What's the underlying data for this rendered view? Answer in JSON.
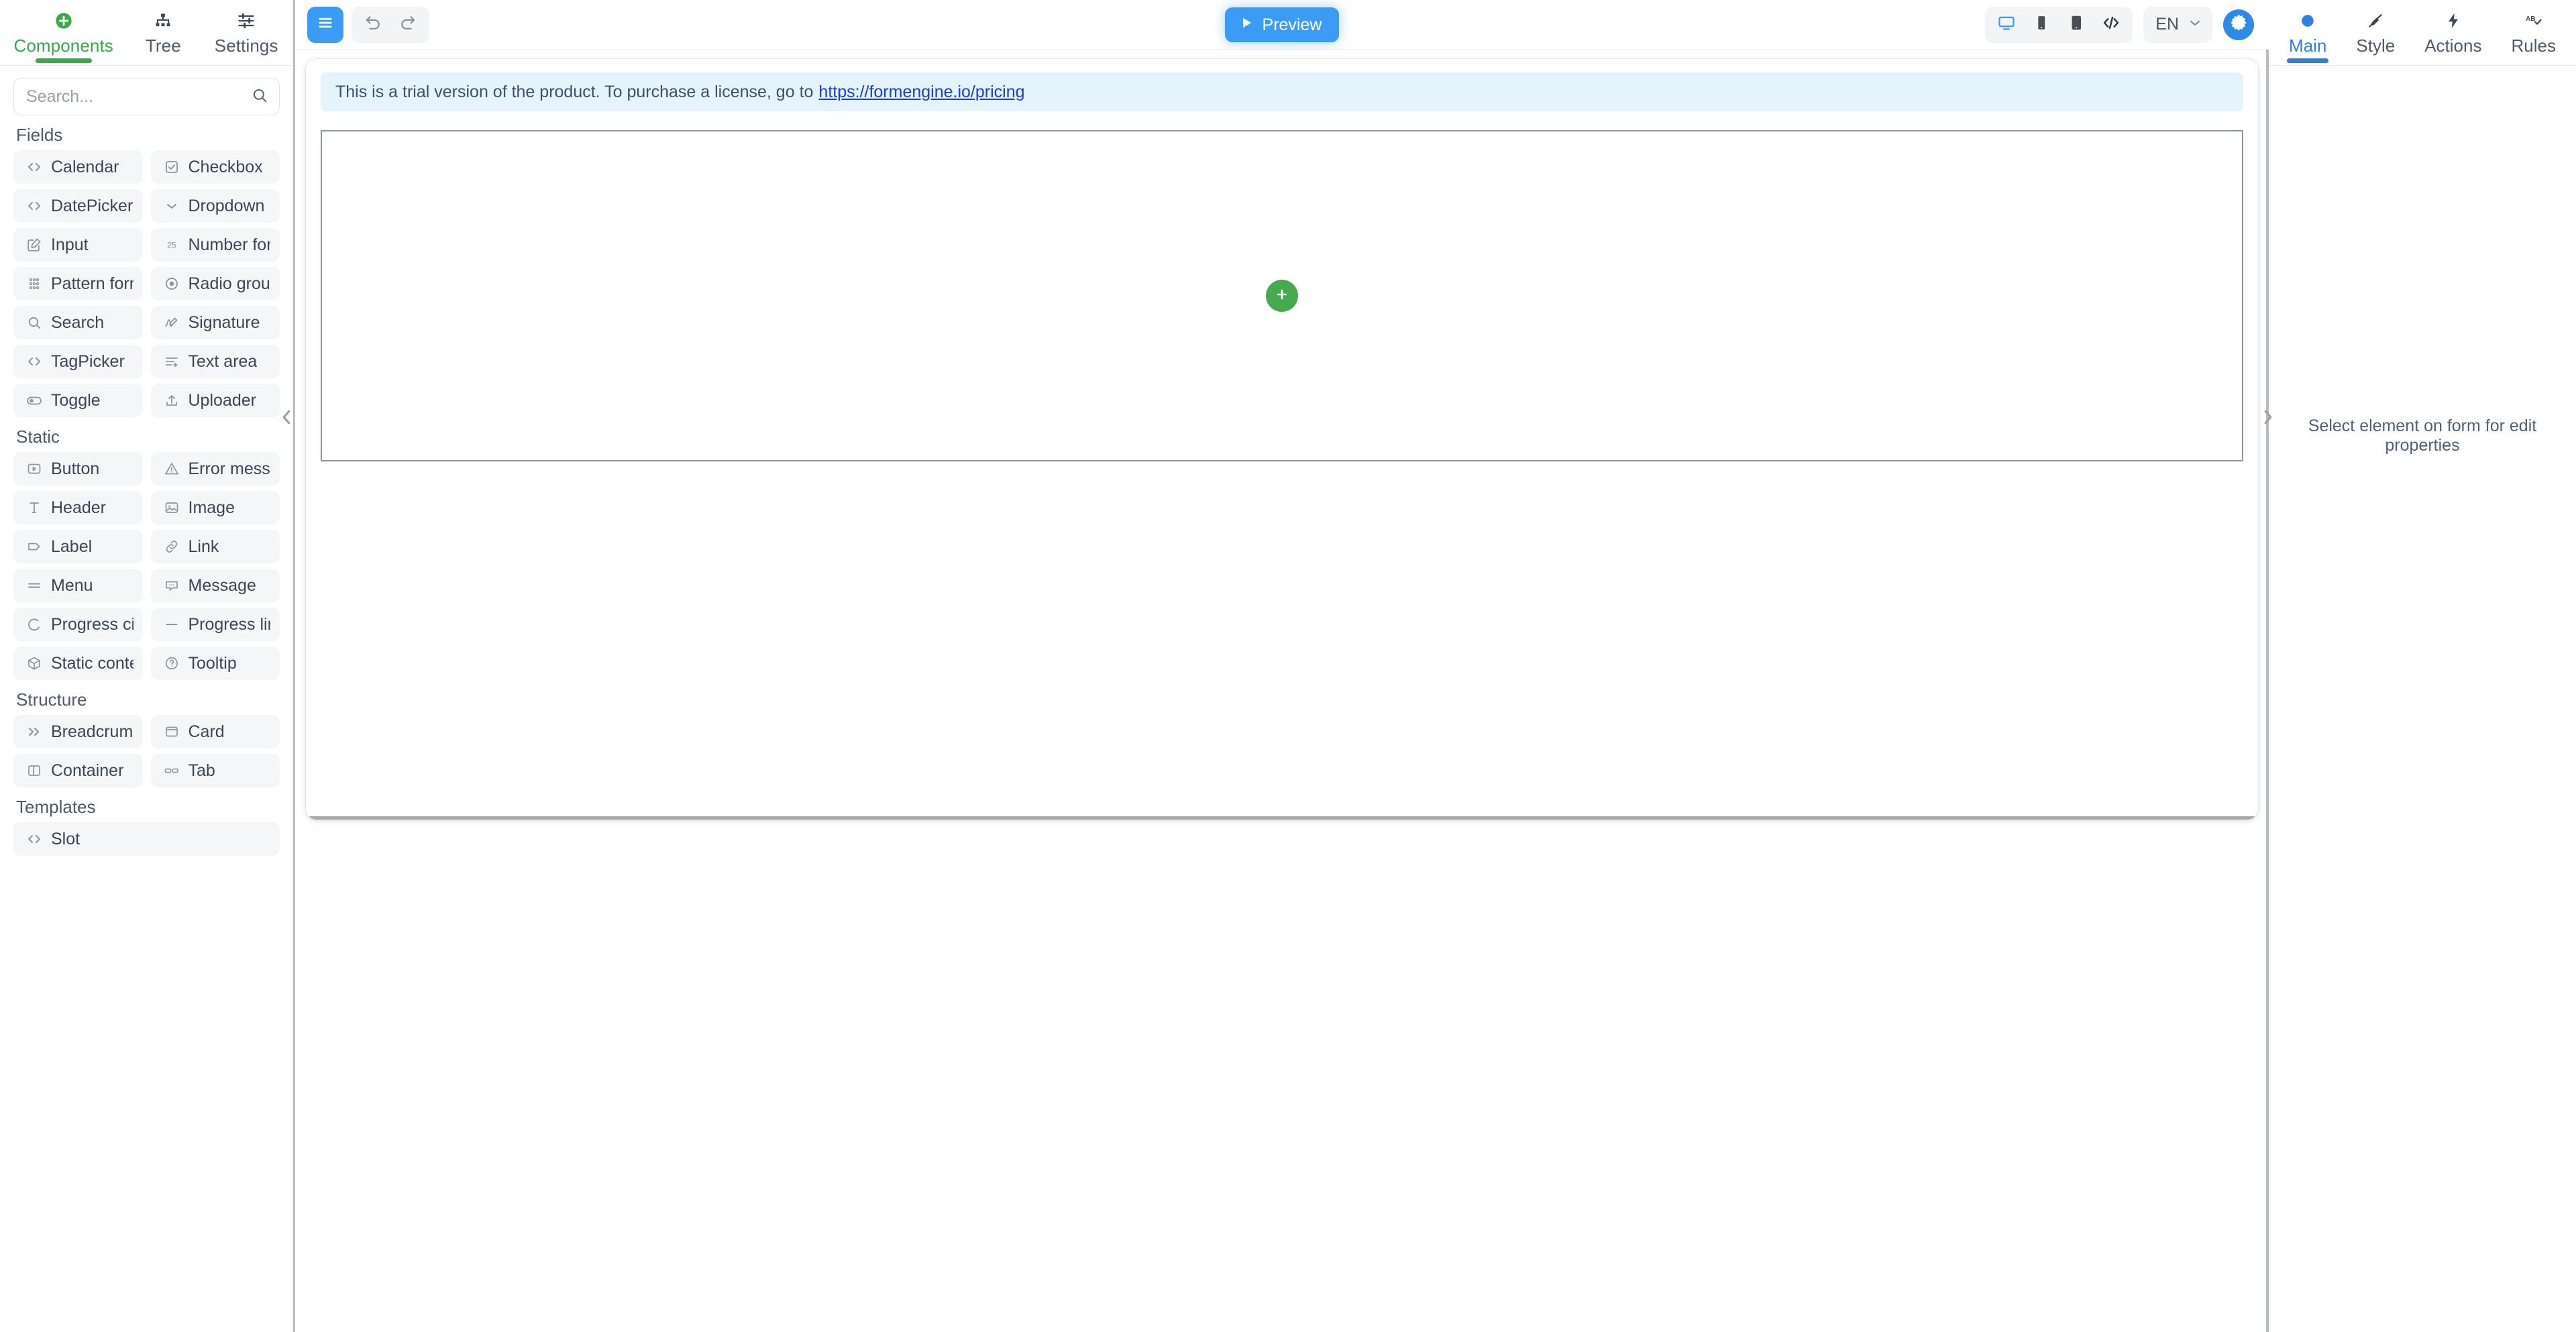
{
  "sidebar": {
    "tabs": [
      {
        "label": "Components",
        "icon": "plus-circle-icon",
        "active": true
      },
      {
        "label": "Tree",
        "icon": "tree-icon",
        "active": false
      },
      {
        "label": "Settings",
        "icon": "sliders-icon",
        "active": false
      }
    ],
    "search": {
      "value": "",
      "placeholder": "Search...",
      "icon": "search-icon"
    },
    "groups": [
      {
        "title": "Fields",
        "layout": "two-column",
        "items": [
          {
            "label": "Calendar",
            "icon": "code-brackets-icon"
          },
          {
            "label": "Checkbox",
            "icon": "checkbox-icon"
          },
          {
            "label": "DatePicker",
            "icon": "code-brackets-icon"
          },
          {
            "label": "Dropdown",
            "icon": "chevron-down-icon"
          },
          {
            "label": "Input",
            "icon": "pencil-square-icon"
          },
          {
            "label": "Number format",
            "icon": "number-25-icon"
          },
          {
            "label": "Pattern format",
            "icon": "dots-grid-icon"
          },
          {
            "label": "Radio group",
            "icon": "radio-icon"
          },
          {
            "label": "Search",
            "icon": "search-icon"
          },
          {
            "label": "Signature",
            "icon": "signature-pen-icon"
          },
          {
            "label": "TagPicker",
            "icon": "code-brackets-icon"
          },
          {
            "label": "Text area",
            "icon": "text-lines-plus-icon"
          },
          {
            "label": "Toggle",
            "icon": "toggle-icon"
          },
          {
            "label": "Uploader",
            "icon": "upload-icon"
          }
        ]
      },
      {
        "title": "Static",
        "layout": "two-column",
        "items": [
          {
            "label": "Button",
            "icon": "button-play-icon"
          },
          {
            "label": "Error message",
            "icon": "warning-triangle-icon"
          },
          {
            "label": "Header",
            "icon": "text-t-icon"
          },
          {
            "label": "Image",
            "icon": "image-icon"
          },
          {
            "label": "Label",
            "icon": "tag-label-icon"
          },
          {
            "label": "Link",
            "icon": "link-chain-icon"
          },
          {
            "label": "Menu",
            "icon": "menu-lines-icon"
          },
          {
            "label": "Message",
            "icon": "speech-bubble-icon"
          },
          {
            "label": "Progress circle",
            "icon": "progress-circle-icon"
          },
          {
            "label": "Progress line",
            "icon": "progress-line-icon"
          },
          {
            "label": "Static content",
            "icon": "cube-icon"
          },
          {
            "label": "Tooltip",
            "icon": "question-circle-icon"
          }
        ]
      },
      {
        "title": "Structure",
        "layout": "two-column",
        "items": [
          {
            "label": "Breadcrumb",
            "icon": "double-chevron-right-icon"
          },
          {
            "label": "Card",
            "icon": "card-icon"
          },
          {
            "label": "Container",
            "icon": "container-split-icon"
          },
          {
            "label": "Tab",
            "icon": "tab-icon"
          }
        ]
      },
      {
        "title": "Templates",
        "layout": "one-column",
        "items": [
          {
            "label": "Slot",
            "icon": "code-brackets-icon"
          }
        ]
      }
    ],
    "collapse_icon": "chevron-left-icon"
  },
  "toolbar": {
    "menu_icon": "hamburger-menu-icon",
    "undo_icon": "undo-icon",
    "redo_icon": "redo-icon",
    "preview_label": "Preview",
    "preview_icon": "play-icon",
    "viewports": [
      {
        "name": "desktop",
        "icon": "desktop-icon",
        "active": true
      },
      {
        "name": "mobile",
        "icon": "mobile-icon",
        "active": false
      },
      {
        "name": "tablet",
        "icon": "tablet-icon",
        "active": false
      },
      {
        "name": "code",
        "icon": "code-slash-icon",
        "active": false
      }
    ],
    "language": {
      "value": "EN",
      "chevron_icon": "chevron-down-icon"
    },
    "settings_icon": "gear-icon"
  },
  "canvas": {
    "trial_text": "This is a trial version of the product. To purchase a license, go to",
    "trial_link": "https://formengine.io/pricing",
    "add_icon": "plus-icon"
  },
  "right_panel": {
    "tabs": [
      {
        "label": "Main",
        "icon": "circle-dot-icon",
        "active": true
      },
      {
        "label": "Style",
        "icon": "paintbrush-icon",
        "active": false
      },
      {
        "label": "Actions",
        "icon": "lightning-bolt-icon",
        "active": false
      },
      {
        "label": "Rules",
        "icon": "ab-check-icon",
        "active": false
      }
    ],
    "hint": "Select element on form for edit properties",
    "collapse_icon": "chevron-right-icon"
  },
  "colors": {
    "brand_green": "#3aa94a",
    "brand_blue": "#3b9bf5",
    "accent_blue": "#2f7fe0",
    "banner_bg": "#e5f3fd",
    "link": "#1a3fd4",
    "fab_green": "#46a94f"
  }
}
